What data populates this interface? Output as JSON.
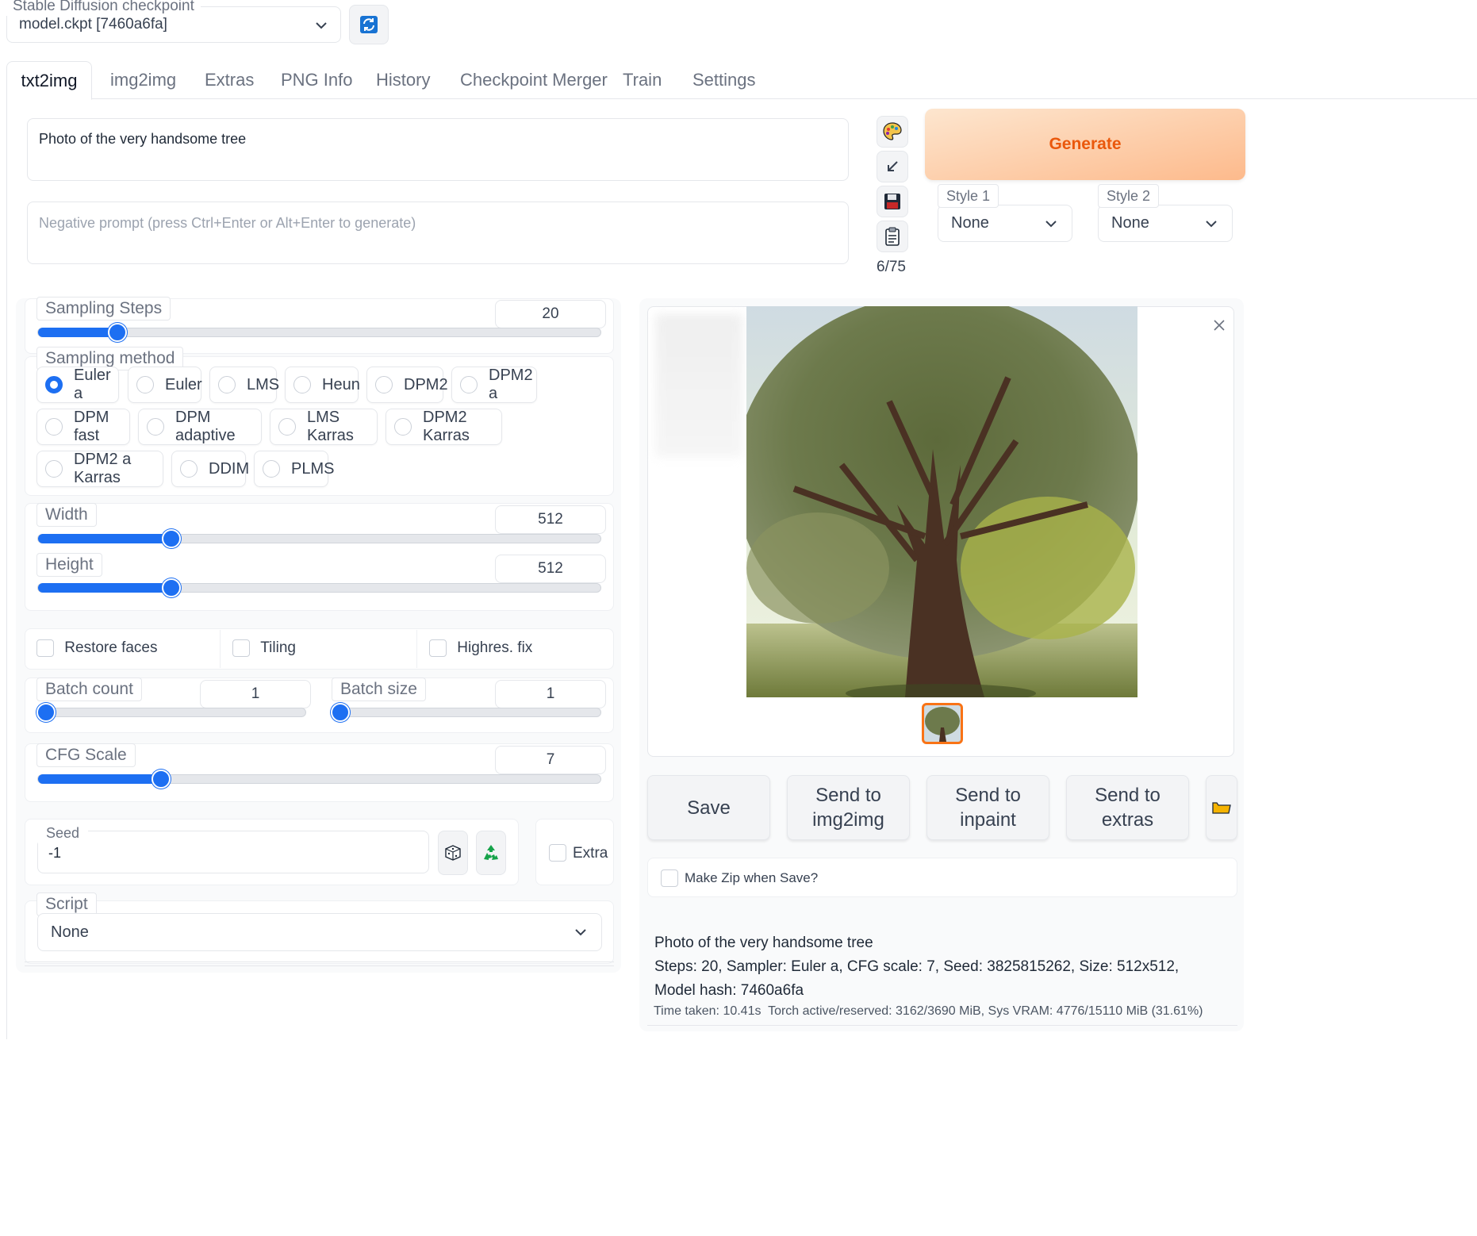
{
  "checkpoint": {
    "label": "Stable Diffusion checkpoint",
    "value": "model.ckpt [7460a6fa]"
  },
  "tabs": [
    "txt2img",
    "img2img",
    "Extras",
    "PNG Info",
    "History",
    "Checkpoint Merger",
    "Train",
    "Settings"
  ],
  "prompt": {
    "value": "Photo of the very handsome tree",
    "negative_placeholder": "Negative prompt (press Ctrl+Enter or Alt+Enter to generate)",
    "token_count": "6/75"
  },
  "generate_label": "Generate",
  "styles": [
    {
      "label": "Style 1",
      "value": "None"
    },
    {
      "label": "Style 2",
      "value": "None"
    }
  ],
  "sampling_steps": {
    "label": "Sampling Steps",
    "value": "20",
    "fraction": 0.13
  },
  "sampling_method": {
    "label": "Sampling method",
    "options": [
      "Euler a",
      "Euler",
      "LMS",
      "Heun",
      "DPM2",
      "DPM2 a",
      "DPM fast",
      "DPM adaptive",
      "LMS Karras",
      "DPM2 Karras",
      "DPM2 a Karras",
      "DDIM",
      "PLMS"
    ],
    "selected": "Euler a"
  },
  "width": {
    "label": "Width",
    "value": "512",
    "fraction": 0.23
  },
  "height": {
    "label": "Height",
    "value": "512",
    "fraction": 0.23
  },
  "checks": {
    "restore_faces": "Restore faces",
    "tiling": "Tiling",
    "highres": "Highres. fix"
  },
  "batch_count": {
    "label": "Batch count",
    "value": "1",
    "fraction": 0.0
  },
  "batch_size": {
    "label": "Batch size",
    "value": "1",
    "fraction": 0.0
  },
  "cfg_scale": {
    "label": "CFG Scale",
    "value": "7",
    "fraction": 0.21
  },
  "seed": {
    "label": "Seed",
    "value": "-1",
    "extra_label": "Extra"
  },
  "script": {
    "label": "Script",
    "value": "None"
  },
  "output_buttons": {
    "save": "Save",
    "send_img2img": "Send to img2img",
    "send_inpaint": "Send to inpaint",
    "send_extras": "Send to extras"
  },
  "make_zip_label": "Make Zip when Save?",
  "info": {
    "prompt": "Photo of the very handsome tree",
    "params": "Steps: 20, Sampler: Euler a, CFG scale: 7, Seed: 3825815262, Size: 512x512, Model hash: 7460a6fa",
    "timing": "Time taken: 10.41s  Torch active/reserved: 3162/3690 MiB, Sys VRAM: 4776/15110 MiB (31.61%)"
  },
  "colors": {
    "accent": "#1d6ff2",
    "generate_text": "#ea580c",
    "generate_bg_start": "#fde6cf",
    "generate_bg_end": "#fdba8c"
  }
}
